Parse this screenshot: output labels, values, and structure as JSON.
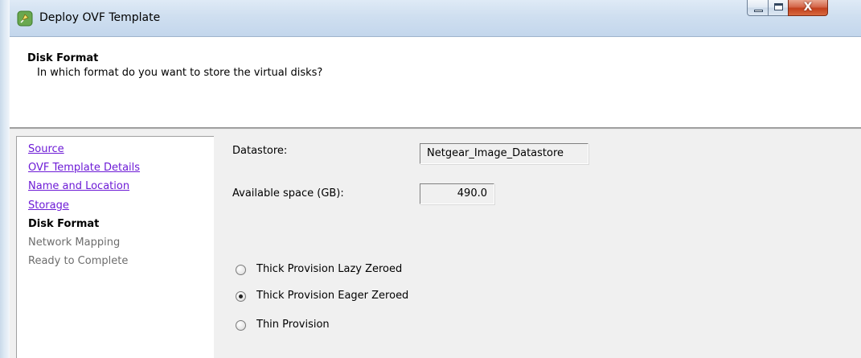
{
  "window": {
    "title": "Deploy OVF Template",
    "close_glyph": "X"
  },
  "header": {
    "title": "Disk Format",
    "subtitle": "In which format do you want to store the virtual disks?"
  },
  "nav": {
    "items": [
      {
        "label": "Source",
        "state": "link"
      },
      {
        "label": "OVF Template Details",
        "state": "link"
      },
      {
        "label": "Name and Location",
        "state": "link"
      },
      {
        "label": "Storage",
        "state": "link"
      },
      {
        "label": "Disk Format",
        "state": "current"
      },
      {
        "label": "Network Mapping",
        "state": "disabled"
      },
      {
        "label": "Ready to Complete",
        "state": "disabled"
      }
    ]
  },
  "form": {
    "datastore_label": "Datastore:",
    "datastore_value": "Netgear_Image_Datastore",
    "space_label": "Available space (GB):",
    "space_value": "490.0",
    "options": [
      {
        "label": "Thick Provision Lazy Zeroed",
        "checked": false
      },
      {
        "label": "Thick Provision Eager Zeroed",
        "checked": true
      },
      {
        "label": "Thin Provision",
        "checked": false
      }
    ]
  },
  "colors": {
    "link": "#6d1bd6",
    "disabled": "#6d6d6d",
    "panel": "#f0f0f0",
    "titlebar": "#cfdff0",
    "close_button": "#c3401d"
  },
  "icons": {
    "app": "vsphere-app-icon",
    "minimize": "minimize-icon",
    "maximize": "maximize-icon",
    "close": "close-icon"
  }
}
